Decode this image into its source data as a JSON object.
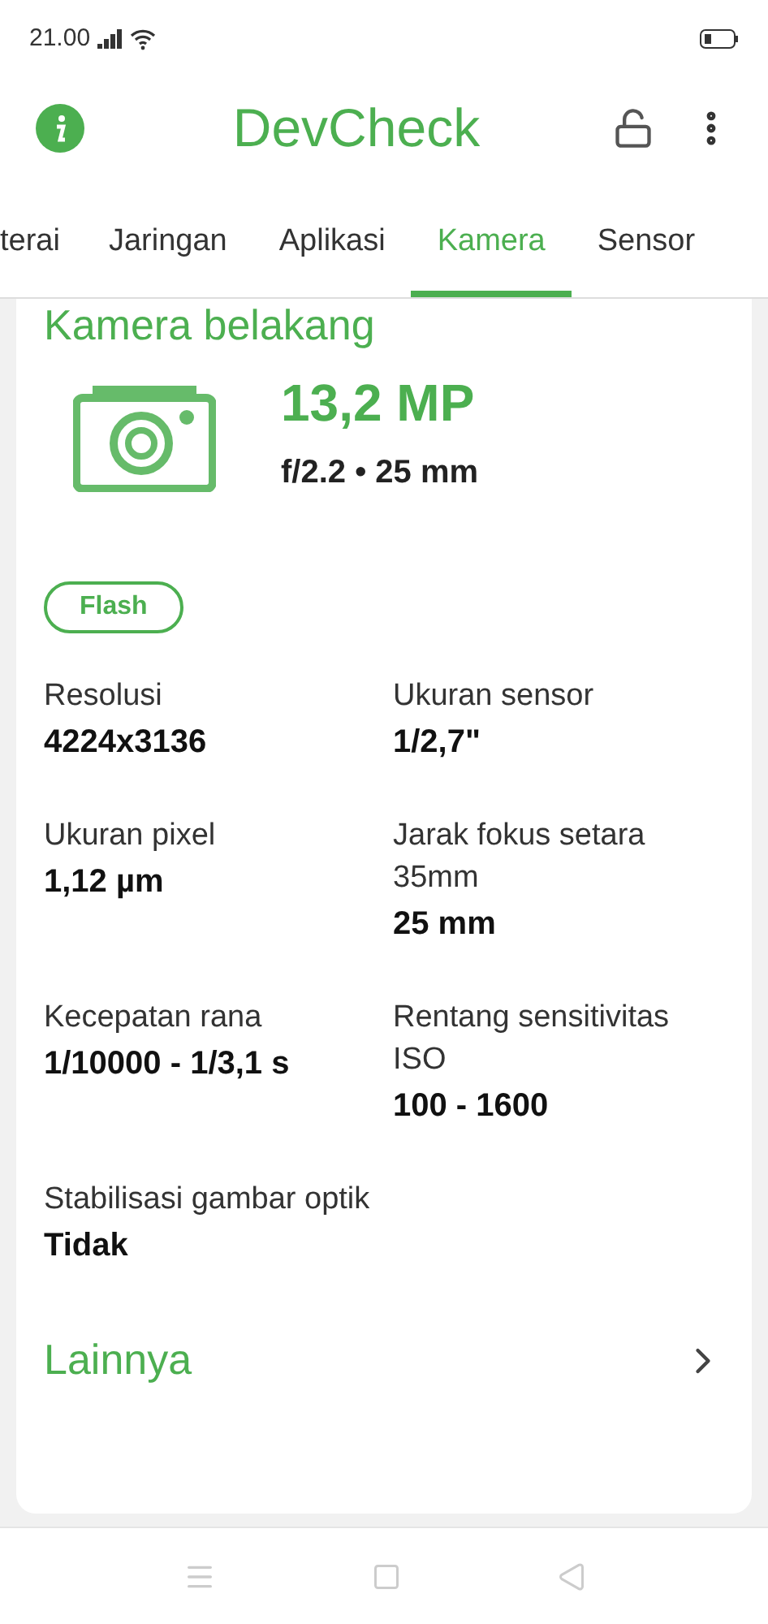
{
  "status_bar": {
    "time": "21.00"
  },
  "app_bar": {
    "title": "DevCheck"
  },
  "tabs": [
    {
      "label": "terai",
      "selected": false
    },
    {
      "label": "Jaringan",
      "selected": false
    },
    {
      "label": "Aplikasi",
      "selected": false
    },
    {
      "label": "Kamera",
      "selected": true
    },
    {
      "label": "Sensor",
      "selected": false
    }
  ],
  "card": {
    "title": "Kamera belakang",
    "megapixels": "13,2 MP",
    "lens": "f/2.2 • 25 mm",
    "badges": [
      "Flash"
    ],
    "specs": [
      {
        "label": "Resolusi",
        "value": "4224x3136"
      },
      {
        "label": "Ukuran sensor",
        "value": "1/2,7\""
      },
      {
        "label": "Ukuran pixel",
        "value": "1,12 µm"
      },
      {
        "label": "Jarak fokus setara 35mm",
        "value": "25 mm"
      },
      {
        "label": "Kecepatan rana",
        "value": "1/10000 - 1/3,1 s"
      },
      {
        "label": "Rentang sensitivitas ISO",
        "value": "100 - 1600"
      },
      {
        "label": "Stabilisasi gambar optik",
        "value": "Tidak"
      }
    ],
    "more": "Lainnya"
  }
}
